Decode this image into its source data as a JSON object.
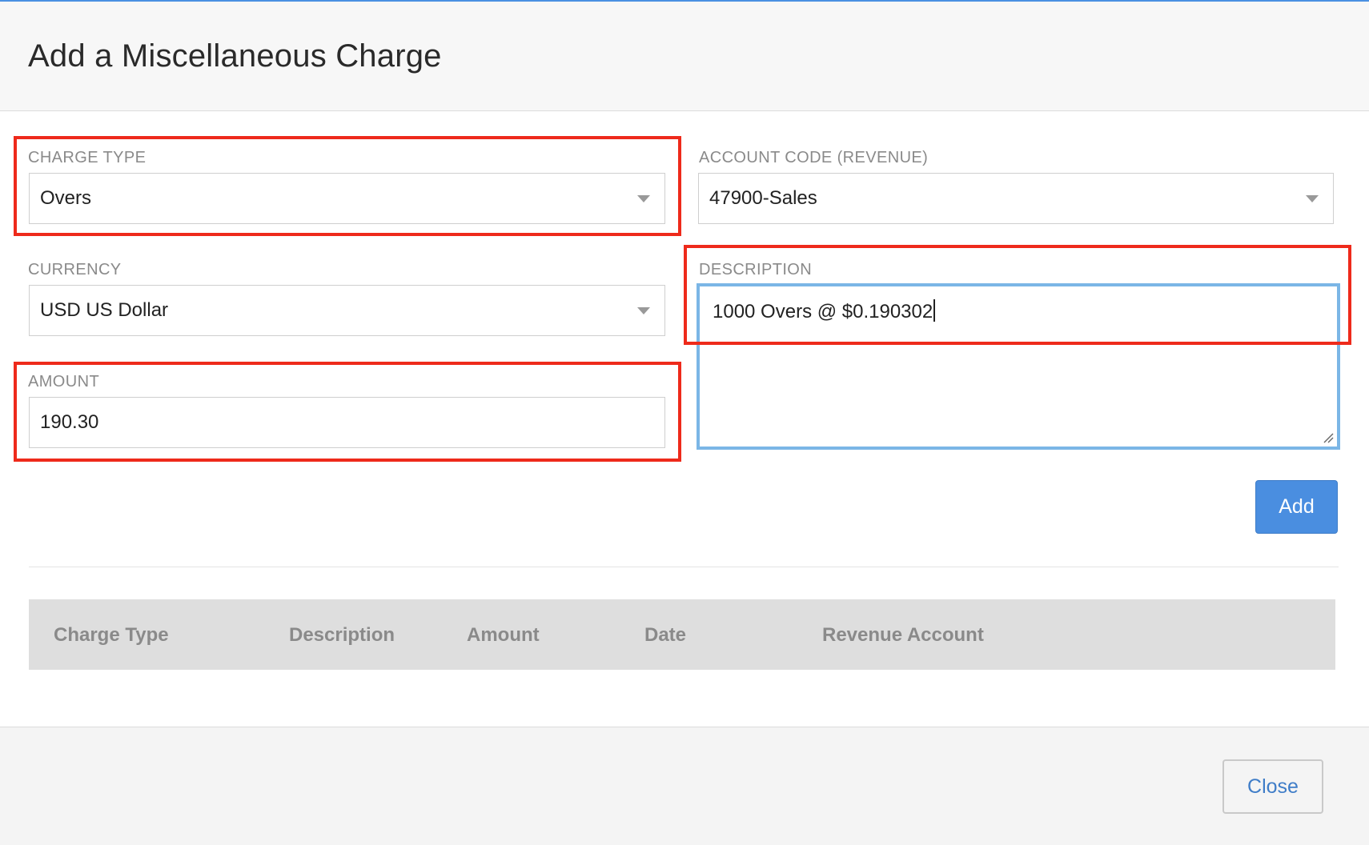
{
  "dialog": {
    "title": "Add a Miscellaneous Charge"
  },
  "form": {
    "charge_type": {
      "label": "CHARGE TYPE",
      "value": "Overs"
    },
    "account_code": {
      "label": "ACCOUNT CODE (REVENUE)",
      "value": "47900-Sales"
    },
    "currency": {
      "label": "CURRENCY",
      "value": "USD US Dollar"
    },
    "description": {
      "label": "DESCRIPTION",
      "value": "1000 Overs @ $0.190302"
    },
    "amount": {
      "label": "AMOUNT",
      "value": "190.30"
    },
    "add_label": "Add"
  },
  "table": {
    "columns": [
      "Charge Type",
      "Description",
      "Amount",
      "Date",
      "Revenue Account"
    ],
    "rows": []
  },
  "footer": {
    "close_label": "Close"
  },
  "colors": {
    "highlight": "#ee2a1b",
    "focus": "#7bb6e6",
    "primary": "#4a8ee0"
  }
}
